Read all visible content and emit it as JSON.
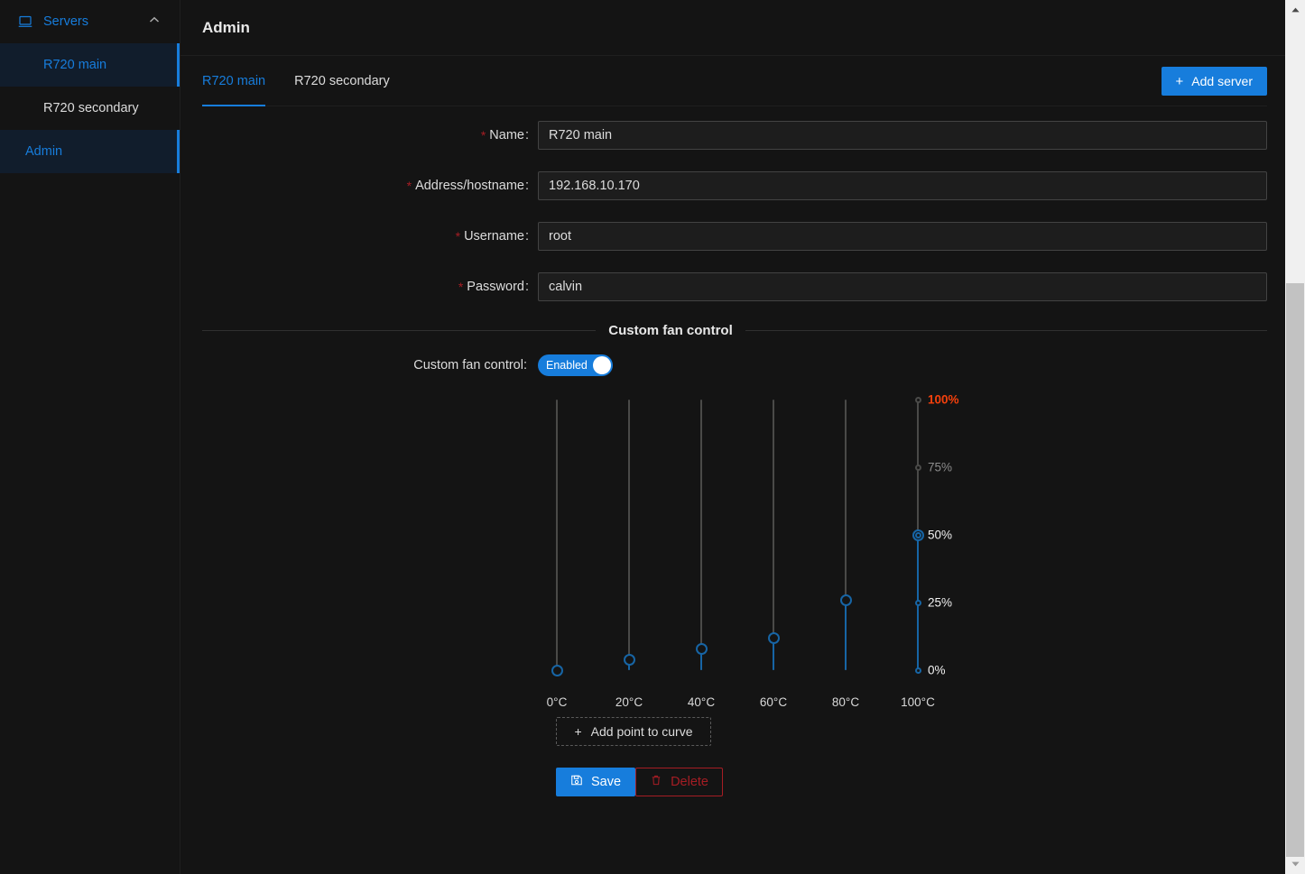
{
  "sidebar": {
    "group": {
      "label": "Servers",
      "icon": "server-monitor-icon",
      "chevron": "chevron-up-icon"
    },
    "items": [
      {
        "label": "R720 main",
        "selected": true
      },
      {
        "label": "R720 secondary",
        "selected": false
      },
      {
        "label": "Admin",
        "selected": true
      }
    ]
  },
  "header": {
    "title": "Admin"
  },
  "tabs": [
    {
      "label": "R720 main",
      "active": true
    },
    {
      "label": "R720 secondary",
      "active": false
    }
  ],
  "add_server_button": {
    "label": "Add server",
    "icon": "plus-icon",
    "color": "#177ddc"
  },
  "form": {
    "fields": [
      {
        "label": "Name",
        "required": true,
        "value": "R720 main",
        "placeholder": ""
      },
      {
        "label": "Address/hostname",
        "required": true,
        "value": "192.168.10.170",
        "placeholder": ""
      },
      {
        "label": "Username",
        "required": true,
        "value": "root",
        "placeholder": ""
      },
      {
        "label": "Password",
        "required": true,
        "value": "calvin",
        "placeholder": ""
      }
    ]
  },
  "divider": {
    "title": "Custom fan control"
  },
  "fan_toggle": {
    "label": "Custom fan control:",
    "state": "Enabled",
    "on": true
  },
  "chart_data": {
    "type": "line",
    "title": "Custom fan control curve",
    "xlabel": "",
    "ylabel": "",
    "x_tick_labels": [
      "0°C",
      "20°C",
      "40°C",
      "60°C",
      "80°C",
      "100°C"
    ],
    "categories": [
      0,
      20,
      40,
      60,
      80,
      100
    ],
    "values": [
      0,
      4,
      8,
      12,
      26,
      50
    ],
    "ylim": [
      0,
      100
    ],
    "y_tick_labels": [
      "0%",
      "25%",
      "50%",
      "75%",
      "100%"
    ],
    "y_ticks": [
      0,
      25,
      50,
      75,
      100
    ],
    "grid": false,
    "legend": false,
    "marks_on_last_slider_only": true,
    "max_mark_color": "#f5400c",
    "accent_color": "#1765a5"
  },
  "add_point_button": {
    "label": "Add point to curve",
    "icon": "plus-icon"
  },
  "actions": {
    "save": {
      "label": "Save",
      "icon": "save-icon",
      "color": "#177ddc"
    },
    "delete": {
      "label": "Delete",
      "icon": "trash-icon",
      "color": "#a61d24"
    }
  },
  "scrollbar": {
    "up": "▲",
    "down": "▼"
  }
}
